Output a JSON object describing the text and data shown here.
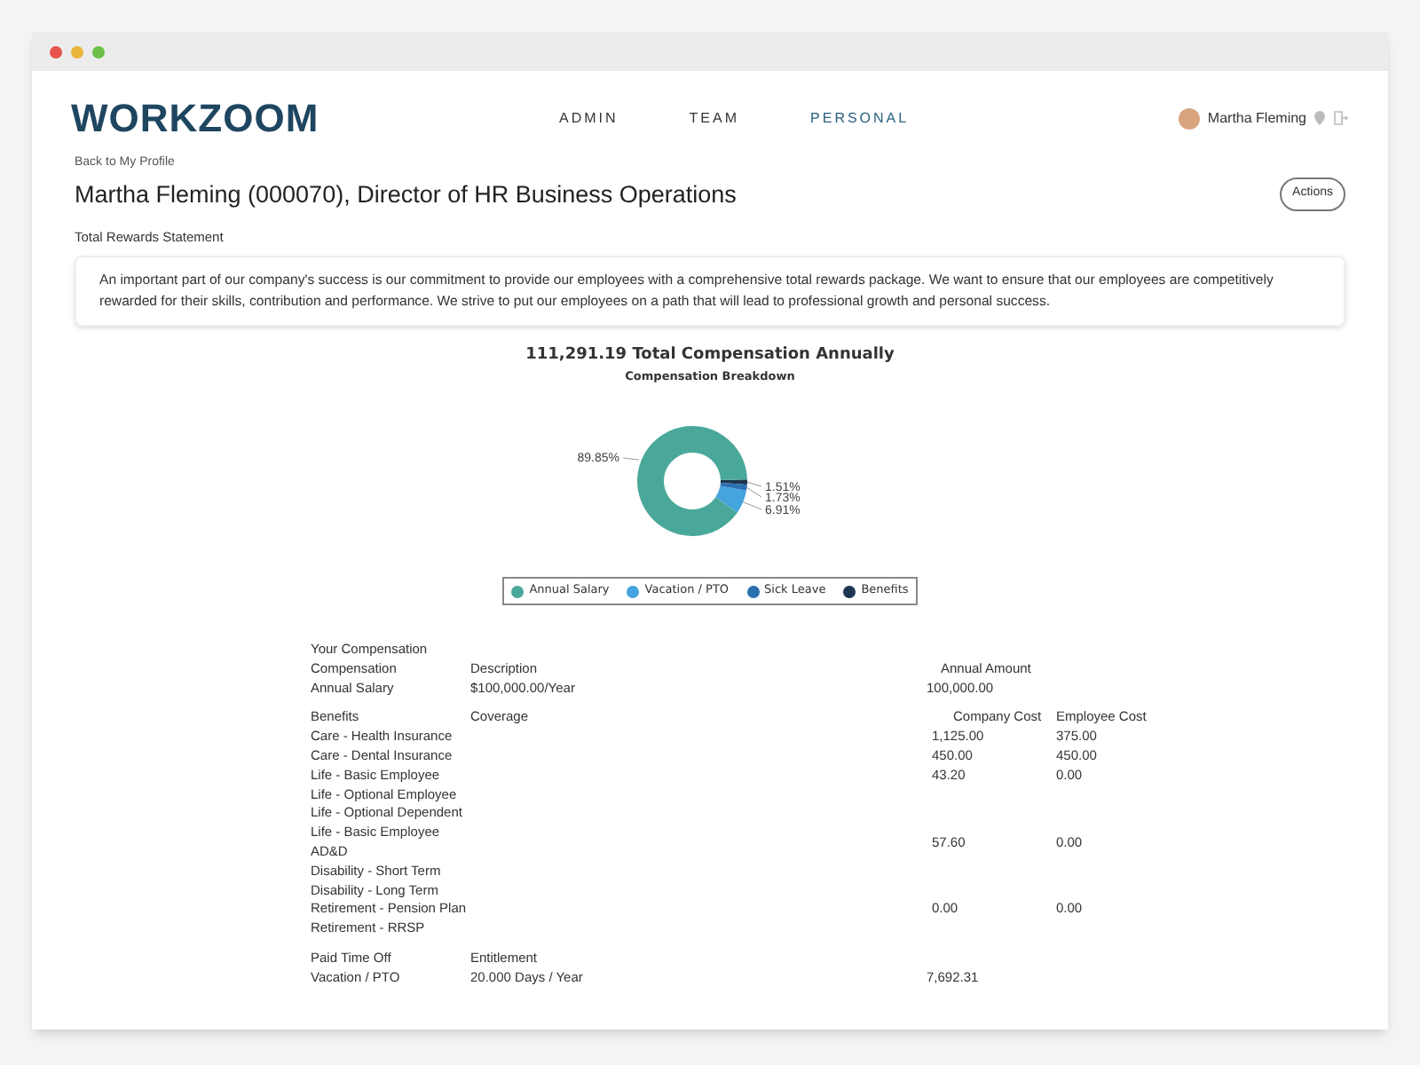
{
  "logo": {
    "text": "WORKZOOM"
  },
  "nav": [
    {
      "label": "ADMIN",
      "selected": false
    },
    {
      "label": "TEAM",
      "selected": false
    },
    {
      "label": "PERSONAL",
      "selected": true
    }
  ],
  "user": {
    "name": "Martha Fleming"
  },
  "back_link": "Back to My Profile",
  "page_title": "Martha Fleming (000070), Director of HR Business Operations",
  "actions_button": "Actions",
  "section_title": "Total Rewards Statement",
  "intro": "An important part of our company's success is our commitment to provide our employees with a comprehensive total rewards package. We want to ensure that our employees are competitively rewarded for their skills, contribution and performance. We strive to put our employees on a path that will lead to professional growth and personal success.",
  "chart": {
    "title": "111,291.19 Total Compensation Annually",
    "subtitle": "Compensation Breakdown",
    "chart_data": {
      "type": "donut",
      "categories": [
        "Annual Salary",
        "Vacation / PTO",
        "Sick Leave",
        "Benefits"
      ],
      "values": [
        89.85,
        6.91,
        1.73,
        1.51
      ],
      "colors": [
        "#4aa89a",
        "#45a3dd",
        "#2b6fb0",
        "#1c3550"
      ],
      "value_labels": [
        "89.85%",
        "6.91%",
        "1.73%",
        "1.51%"
      ]
    }
  },
  "compensation": {
    "heading": "Your Compensation",
    "columns": [
      "Compensation",
      "Description",
      "Annual Amount"
    ],
    "rows": [
      {
        "name": "Annual Salary",
        "description": "$100,000.00/Year",
        "amount": "100,000.00"
      }
    ]
  },
  "benefits": {
    "columns": [
      "Benefits",
      "Coverage",
      "Company Cost",
      "Employee Cost"
    ],
    "rows": [
      {
        "name": "Care - Health Insurance",
        "company": "1,125.00",
        "employee": "375.00"
      },
      {
        "name": "Care - Dental Insurance",
        "company": "450.00",
        "employee": "450.00"
      },
      {
        "name": "Life - Basic Employee",
        "company": "43.20",
        "employee": "0.00"
      },
      {
        "name": "Life - Optional Employee"
      },
      {
        "name": "Life - Optional Dependent"
      },
      {
        "name": "Life - Basic Employee AD&D",
        "company": "57.60",
        "employee": "0.00"
      },
      {
        "name": "Disability - Short Term"
      },
      {
        "name": "Disability - Long Term"
      },
      {
        "name": "Retirement - Pension Plan",
        "company": "0.00",
        "employee": "0.00"
      },
      {
        "name": "Retirement - RRSP"
      }
    ]
  },
  "pto": {
    "columns": [
      "Paid Time Off",
      "Entitlement"
    ],
    "rows": [
      {
        "name": "Vacation / PTO",
        "entitlement": "20.000 Days / Year",
        "amount": "7,692.31"
      }
    ]
  }
}
